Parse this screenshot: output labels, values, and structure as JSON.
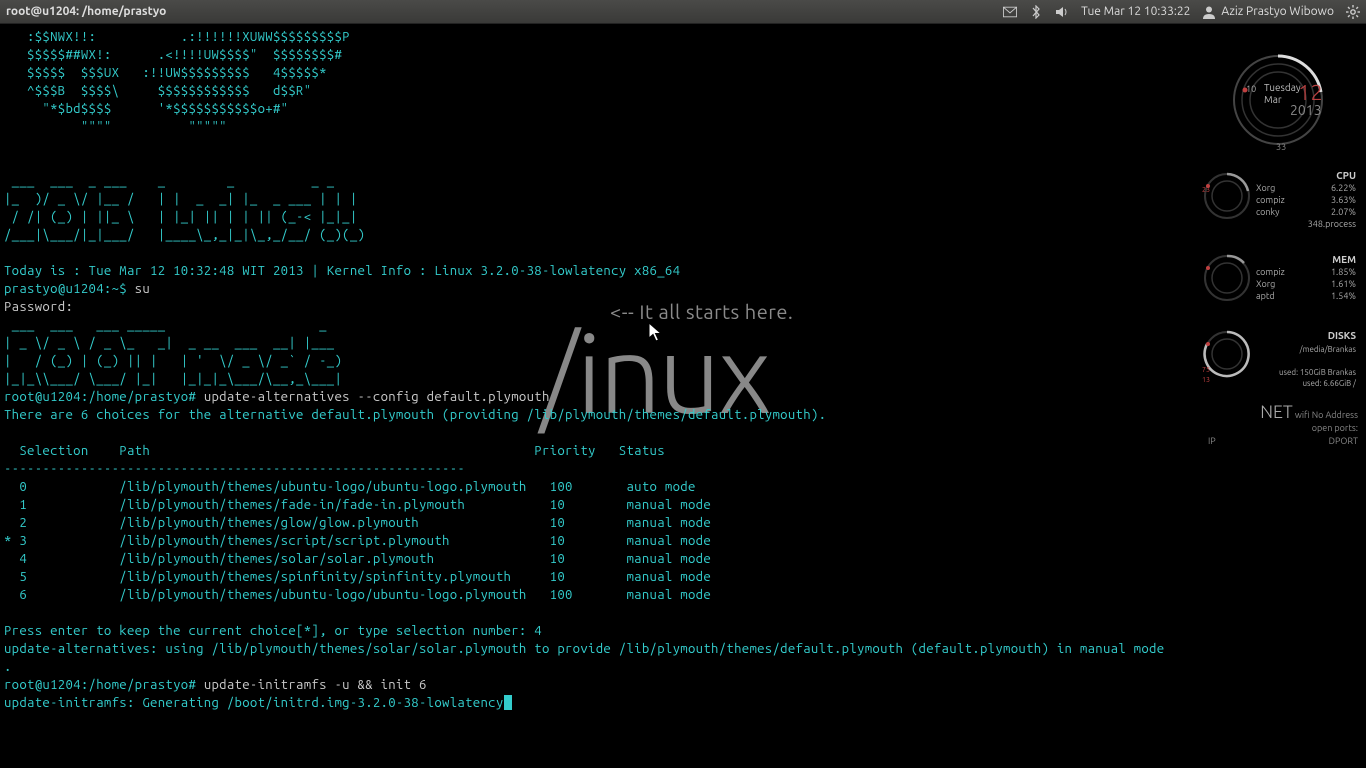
{
  "topbar": {
    "title": "root@u1204: /home/prastyo",
    "datetime": "Tue Mar 12 10:33:22",
    "username": "Aziz Prastyo Wibowo"
  },
  "wallpaper": {
    "tagline": "<-- It all starts here.",
    "word": "/inux"
  },
  "terminal": {
    "ascii_top": "   :$$NWX!!:           .:!!!!!!XUWW$$$$$$$$$P\n   $$$$$##WX!:      .<!!!!UW$$$$\"  $$$$$$$$#\n   $$$$$  $$$UX   :!!UW$$$$$$$$$   4$$$$$*\n   ^$$$B  $$$$\\     $$$$$$$$$$$$   d$$R\"\n     \"*$bd$$$$      '*$$$$$$$$$$$o+#\"\n          \"\"\"\"          \"\"\"\"\"",
    "ascii_2013": " ___  ___  _ ___    _        _          _ _ \n|_  )/ _ \\/ |__ /   | |  _  _| |_  _ ___ | | |\n / /| (_) | ||_ \\   | |_| || | | || (_-< |_|_|\n/___|\\___/|_|___/   |____\\_,_|_|\\_,_/__/ (_)(_)",
    "today_line": "Today is : Tue Mar 12 10:32:48 WIT 2013 | Kernel Info : Linux 3.2.0-38-lowlatency x86_64",
    "prompt_user": "prastyo@u1204:~$ ",
    "su_cmd": "su",
    "password_label": "Password:",
    "ascii_root": " ___  ___   ___ _____                    _     \n| _ \\/ _ \\ / _ \\_   _|  _ __  ___  __| |___ \n|   / (_) | (_) || |   | '  \\/ _ \\/ _` / -_)\n|_|_\\\\___/ \\___/ |_|   |_|_|_\\___/\\__,_\\___|",
    "root_prompt": "root@u1204:/home/prastyo# ",
    "cmd1": "update-alternatives --config default.plymouth",
    "choices_line": "There are 6 choices for the alternative default.plymouth (providing /lib/plymouth/themes/default.plymouth).",
    "table_header": "  Selection    Path                                                  Priority   Status",
    "table_divider": "------------------------------------------------------------",
    "table_rows": [
      "  0            /lib/plymouth/themes/ubuntu-logo/ubuntu-logo.plymouth   100       auto mode",
      "  1            /lib/plymouth/themes/fade-in/fade-in.plymouth           10        manual mode",
      "  2            /lib/plymouth/themes/glow/glow.plymouth                 10        manual mode",
      "* 3            /lib/plymouth/themes/script/script.plymouth             10        manual mode",
      "  4            /lib/plymouth/themes/solar/solar.plymouth               10        manual mode",
      "  5            /lib/plymouth/themes/spinfinity/spinfinity.plymouth     10        manual mode",
      "  6            /lib/plymouth/themes/ubuntu-logo/ubuntu-logo.plymouth   100       manual mode"
    ],
    "press_enter": "Press enter to keep the current choice[*], or type selection number: 4",
    "using_line": "update-alternatives: using /lib/plymouth/themes/solar/solar.plymouth to provide /lib/plymouth/themes/default.plymouth (default.plymouth) in manual mode",
    "dot": ".",
    "cmd2": "update-initramfs -u && init 6",
    "gen_line": "update-initramfs: Generating /boot/initrd.img-3.2.0-38-lowlatency"
  },
  "widgets": {
    "clock": {
      "hour": "10",
      "weekday": "Tuesday",
      "month": "Mar",
      "day": "12",
      "year": "2013",
      "tick": "33"
    },
    "cpu": {
      "title": "CPU",
      "rows": [
        {
          "name": "Xorg",
          "val": "6.22%"
        },
        {
          "name": "compiz",
          "val": "3.63%"
        },
        {
          "name": "conky",
          "val": "2.07%"
        }
      ],
      "summary": "348.process"
    },
    "mem": {
      "title": "MEM",
      "rows": [
        {
          "name": "compiz",
          "val": "1.85%"
        },
        {
          "name": "Xorg",
          "val": "1.61%"
        },
        {
          "name": "aptd",
          "val": "1.54%"
        }
      ]
    },
    "disks": {
      "title": "DISKS",
      "sub": "/media/Brankas",
      "used1": "used: 150GiB Brankas",
      "used2": "used: 6.66GiB /"
    },
    "net": {
      "title": "NET",
      "status": "wifi No Address",
      "ports": "open ports:",
      "ip": "IP",
      "dport": "DPORT"
    }
  }
}
